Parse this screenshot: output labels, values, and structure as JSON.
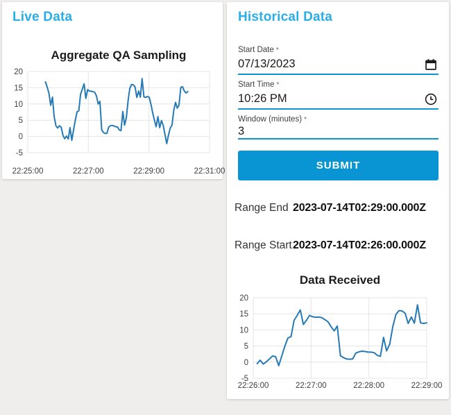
{
  "colors": {
    "heading_accent": "#2aaeea",
    "primary": "#0995d4",
    "chart_line": "#2579b5",
    "grid": "#e4e4e4",
    "tick_text": "#3f3f3f",
    "chart_title_text": "#1c1c1c",
    "card_bg": "#ffffff",
    "page_bg": "#efeeed"
  },
  "live_panel": {
    "heading": "Live Data"
  },
  "historical_panel": {
    "heading": "Historical Data",
    "fields": [
      {
        "label": "Start Date",
        "required_marker": "*",
        "value": "07/13/2023",
        "icon": "calendar-icon"
      },
      {
        "label": "Start Time",
        "required_marker": "*",
        "value": "10:26 PM",
        "icon": "clock-icon"
      },
      {
        "label": "Window (minutes)",
        "required_marker": "*",
        "value": "3",
        "icon": ""
      }
    ],
    "submit_label": "SUBMIT",
    "results": [
      {
        "label": "Range End",
        "value": "2023-07-14T02:29:00.000Z"
      },
      {
        "label": "Range Start",
        "value": "2023-07-14T02:26:00.000Z"
      }
    ]
  },
  "chart_data": [
    {
      "type": "line",
      "title": "Aggregate QA Sampling",
      "xlabel": "",
      "ylabel": "",
      "legend": false,
      "grid": true,
      "x_tick_labels": [
        "22:25:00",
        "22:27:00",
        "22:29:00",
        "22:31:00"
      ],
      "x_tick_seconds": [
        0,
        120,
        240,
        360
      ],
      "x_range_seconds": [
        0,
        360
      ],
      "y_ticks": [
        20,
        15,
        10,
        5,
        0,
        -5
      ],
      "ylim": [
        -5,
        20
      ],
      "series_t_range": [
        35,
        317
      ],
      "values": [
        16.8,
        15.2,
        13.3,
        9.6,
        12.1,
        6.0,
        3.2,
        2.6,
        3.3,
        2.8,
        0.3,
        -0.7,
        0.1,
        -0.8,
        2.7,
        -1.2,
        2.0,
        5.0,
        7.6,
        7.9,
        13.0,
        14.6,
        16.2,
        11.7,
        14.4,
        14.0,
        13.9,
        13.8,
        13.6,
        12.5,
        10.0,
        10.8,
        2.0,
        1.2,
        0.9,
        1.0,
        2.9,
        3.3,
        3.4,
        3.2,
        3.0,
        2.9,
        2.0,
        1.8,
        7.7,
        3.5,
        5.6,
        11.0,
        14.8,
        16.0,
        15.9,
        15.2,
        12.0,
        14.0,
        12.1,
        17.8,
        12.2,
        12.0,
        12.3,
        12.1,
        10.0,
        7.3,
        5.0,
        3.0,
        6.1,
        2.7,
        4.9,
        3.4,
        0.6,
        -2.2,
        0.4,
        2.6,
        3.5,
        8.0,
        10.5,
        8.7,
        9.7,
        15.1,
        15.3,
        14.0,
        13.4,
        13.8
      ]
    },
    {
      "type": "line",
      "title": "Data Received",
      "xlabel": "",
      "ylabel": "",
      "legend": false,
      "grid": true,
      "x_tick_labels": [
        "22:26:00",
        "22:27:00",
        "22:28:00",
        "22:29:00"
      ],
      "x_tick_seconds": [
        0,
        60,
        120,
        180
      ],
      "x_range_seconds": [
        0,
        180
      ],
      "y_ticks": [
        20,
        15,
        10,
        5,
        0,
        -5
      ],
      "ylim": [
        -5,
        20
      ],
      "series_t_range": [
        4,
        180
      ],
      "values": [
        -0.5,
        0.6,
        -0.6,
        0.1,
        1.0,
        1.9,
        1.7,
        -1.1,
        1.9,
        5.0,
        7.5,
        7.9,
        13.0,
        14.5,
        16.2,
        11.7,
        13.0,
        14.5,
        14.1,
        13.9,
        14.0,
        13.8,
        13.2,
        12.5,
        11.0,
        9.7,
        11.2,
        2.0,
        1.4,
        1.0,
        0.9,
        1.0,
        2.8,
        3.2,
        3.4,
        3.3,
        3.1,
        3.1,
        2.9,
        2.1,
        1.8,
        7.7,
        3.5,
        5.6,
        11.0,
        14.8,
        16.0,
        15.9,
        15.2,
        12.0,
        14.0,
        12.1,
        17.8,
        12.2,
        12.0,
        12.2
      ]
    }
  ]
}
